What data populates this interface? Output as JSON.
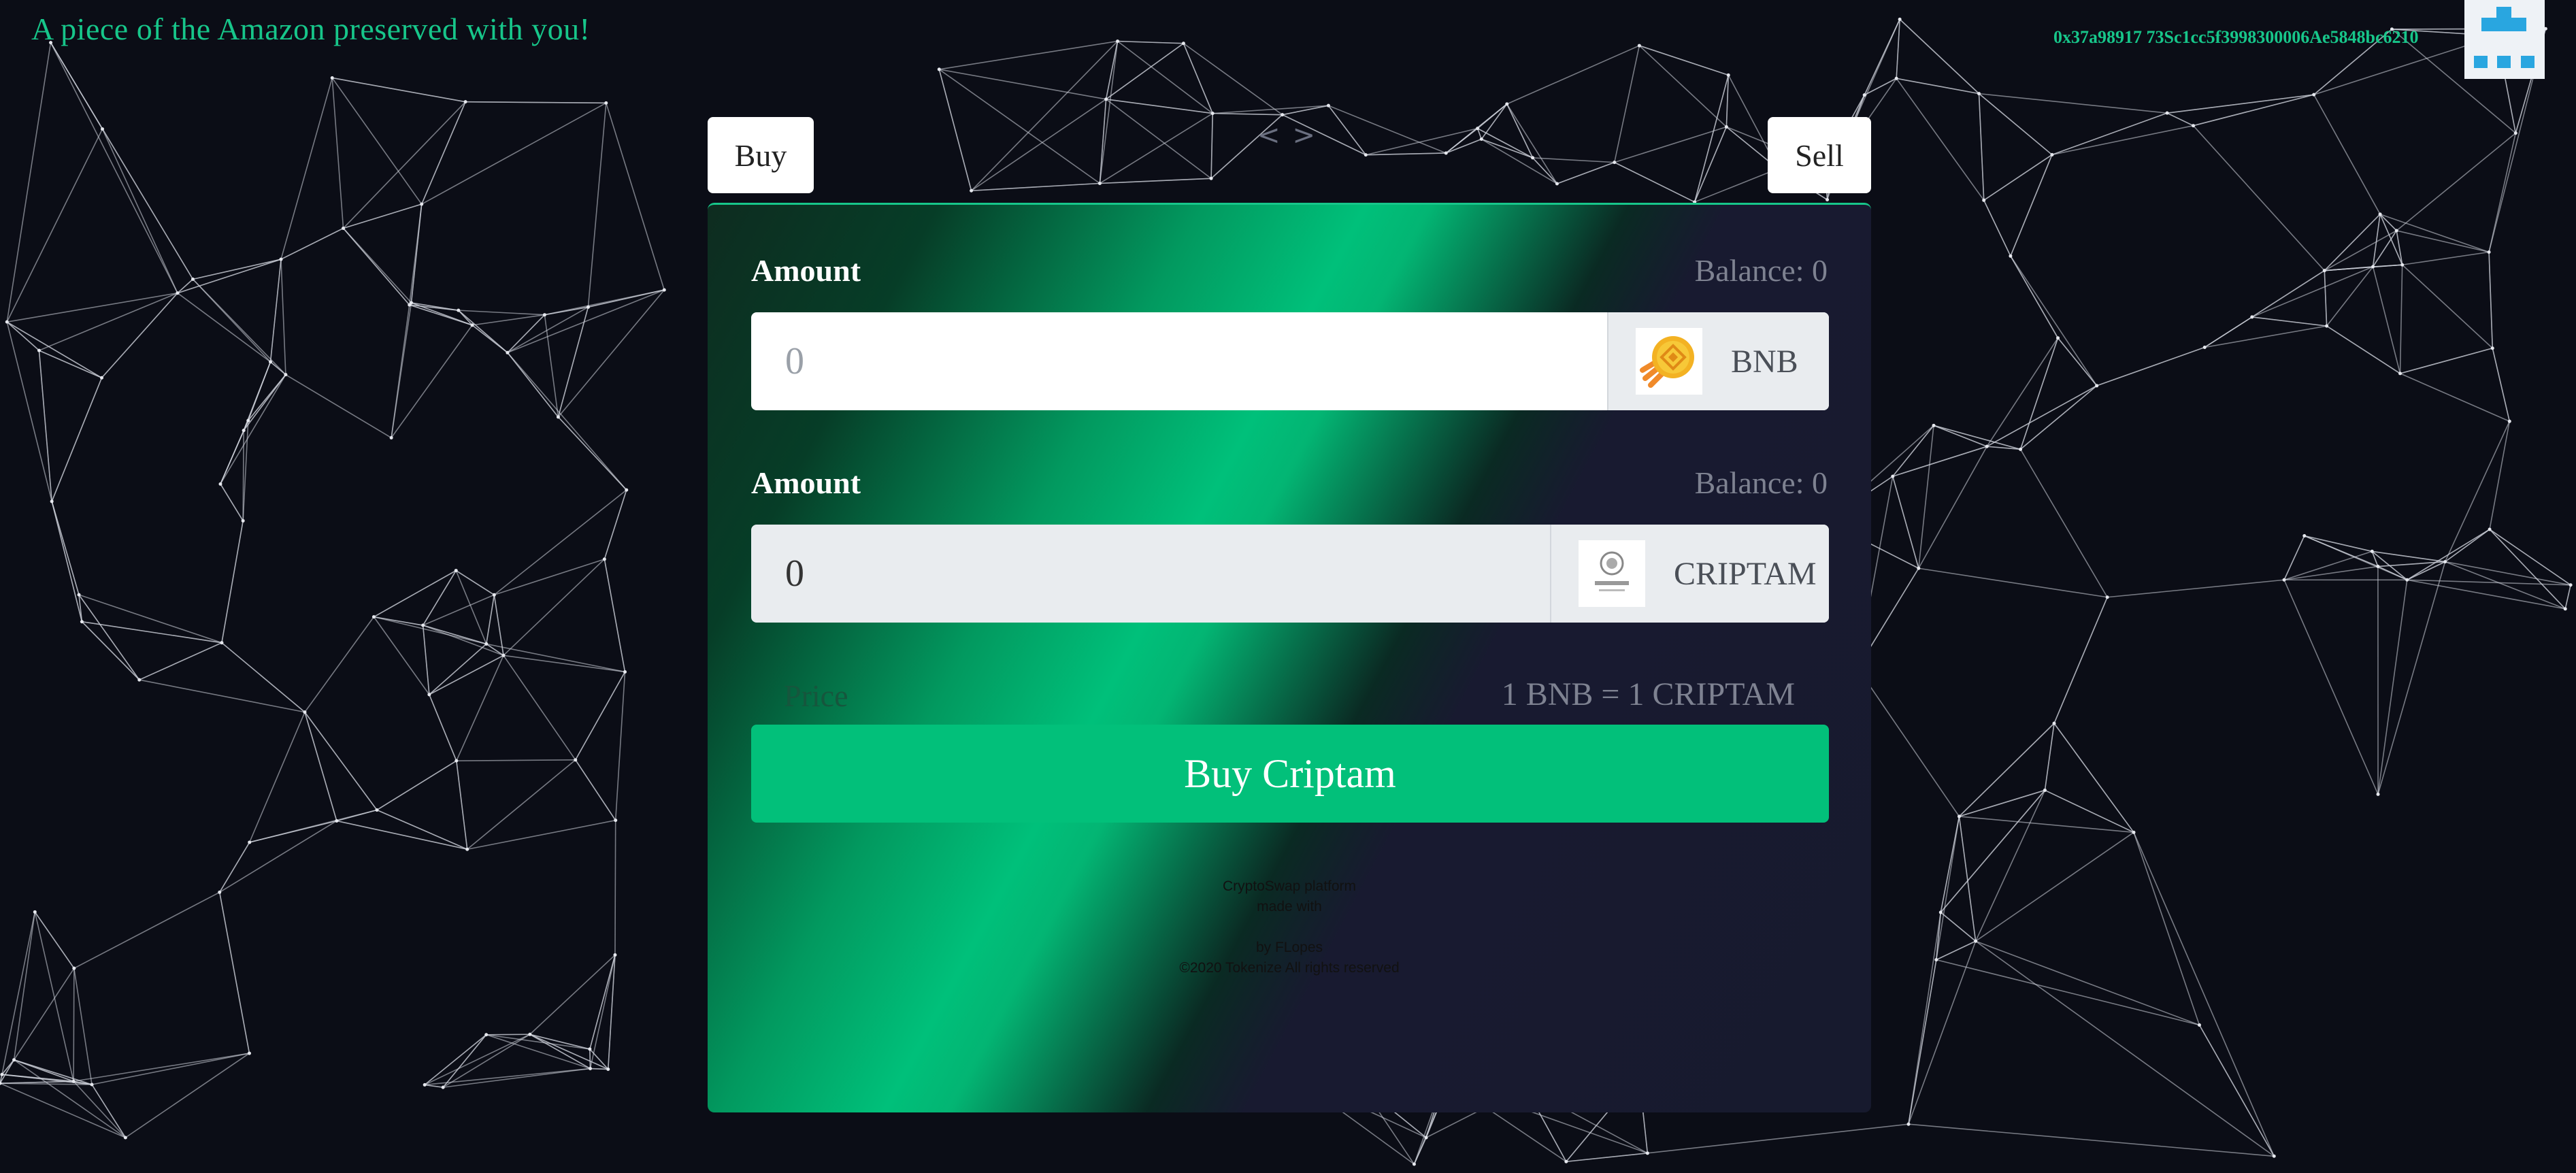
{
  "header": {
    "tagline": "A piece of the Amazon preserved with you!",
    "wallet_address": "0x37a9891⁢7 73Sc1cc5f3998300006Ae5848bc6210"
  },
  "icons": {
    "avatar": "identicon-avatar",
    "bnb_token": "bnb-coin-icon",
    "criptam_token": "criptam-logo-icon",
    "prev": "chevron-left-icon",
    "next": "chevron-right-icon"
  },
  "tabs": {
    "buy_label": "Buy",
    "sell_label": "Sell",
    "prev_arrow": "<",
    "next_arrow": ">"
  },
  "swap": {
    "from": {
      "amount_label": "Amount",
      "balance": "Balance: 0",
      "placeholder": "0",
      "token": "BNB"
    },
    "to": {
      "amount_label": "Amount",
      "balance": "Balance: 0",
      "placeholder": "0",
      "token": "CRIPTAM"
    },
    "price_label": "Price",
    "price_value": "1 BNB = 1 CRIPTAM",
    "action_label": "Buy Criptam"
  },
  "footer": {
    "line1": "CryptoSwap platform",
    "line2": "made with",
    "line3": "by FLopes",
    "line4": "©2020 Tokenize All rights reserved"
  },
  "colors": {
    "background": "#0b0d16",
    "accent": "#02c07a",
    "card": "#171a2e"
  }
}
